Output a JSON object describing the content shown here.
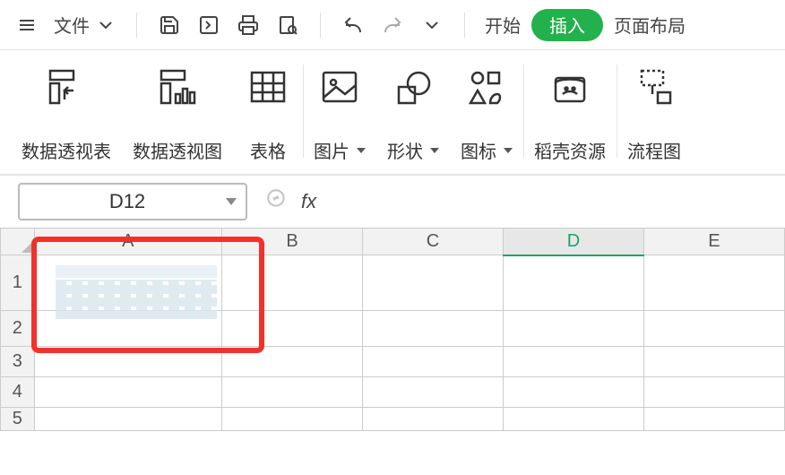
{
  "titlebar": {
    "file_label": "文件",
    "menu_tabs": {
      "start": "开始",
      "insert": "插入",
      "page_layout": "页面布局"
    }
  },
  "ribbon": {
    "pivot_table": "数据透视表",
    "pivot_chart": "数据透视图",
    "table": "表格",
    "picture": "图片",
    "shapes": "形状",
    "icons": "图标",
    "docer": "稻壳资源",
    "flowchart": "流程图"
  },
  "formula_bar": {
    "name_box": "D12",
    "fx_label": "fx",
    "formula_value": ""
  },
  "grid": {
    "columns": [
      "A",
      "B",
      "C",
      "D",
      "E"
    ],
    "rows": [
      "1",
      "2",
      "3",
      "4",
      "5"
    ],
    "selected_column": "D",
    "selected_cell": "D12"
  }
}
